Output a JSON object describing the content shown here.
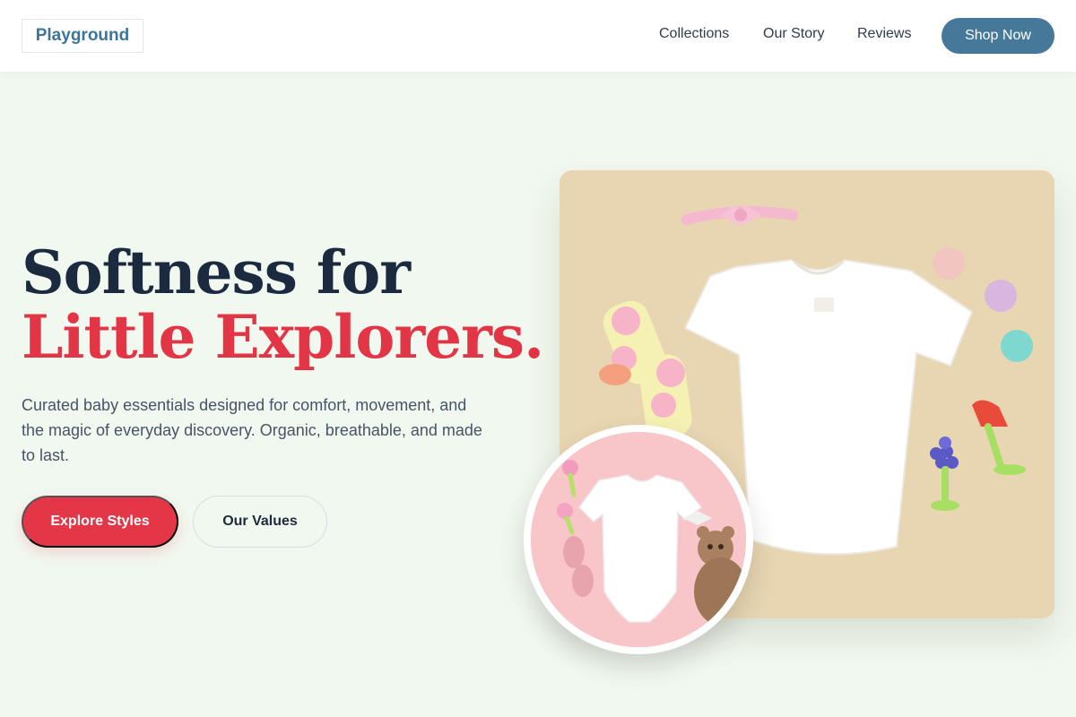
{
  "brand": {
    "name": "Playground"
  },
  "nav": {
    "links": [
      "Collections",
      "Our Story",
      "Reviews"
    ],
    "cta": "Shop Now"
  },
  "hero": {
    "headline_line1": "Softness for",
    "headline_line2": "Little Explorers.",
    "description": "Curated baby essentials designed for comfort, movement, and the magic of everyday discovery. Organic, breathable, and made to last.",
    "primary_cta": "Explore Styles",
    "secondary_cta": "Our Values"
  },
  "images": {
    "main": "baby-clothes-flatlay-image",
    "inset": "baby-onesie-flatlay-image"
  },
  "colors": {
    "page_bg": "#f1f8ef",
    "brand_blue": "#467999",
    "accent_red": "#e33647",
    "heading_navy": "#1c2a40",
    "photo_beige": "#e7d5b1",
    "photo_pink": "#f8c6c8"
  }
}
